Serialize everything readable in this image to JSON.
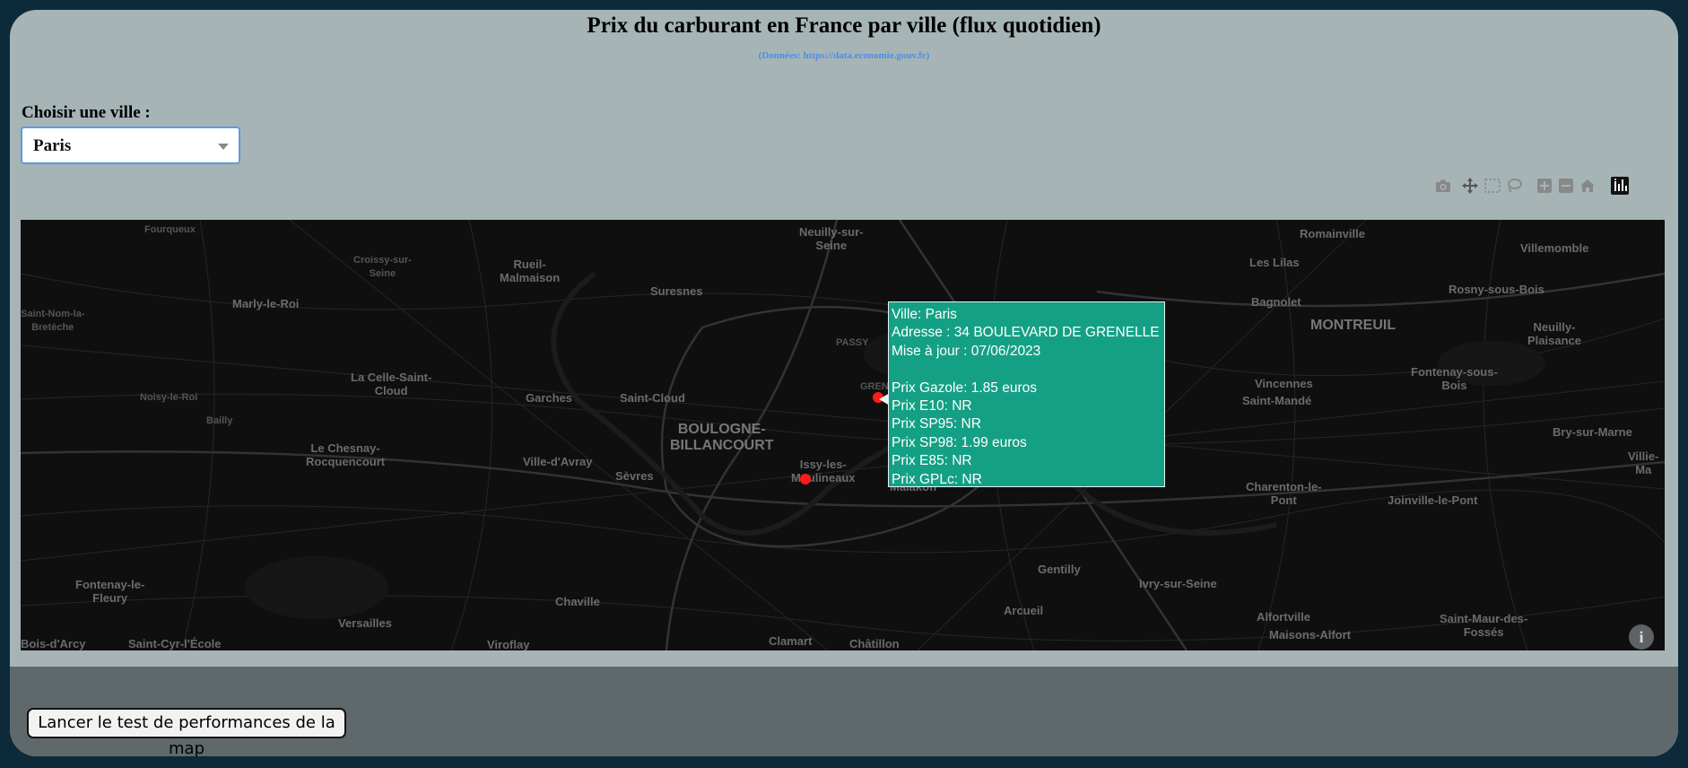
{
  "header": {
    "title": "Prix du carburant en France par ville (flux quotidien)",
    "subtitle": "(Données: https://data.economie.gouv.fr)"
  },
  "city_selector": {
    "label": "Choisir une ville :",
    "selected": "Paris"
  },
  "modebar": {
    "icons": [
      "camera-icon",
      "pan-icon",
      "box-select-icon",
      "lasso-icon",
      "zoom-in-icon",
      "zoom-out-icon",
      "home-icon",
      "plotly-logo-icon"
    ]
  },
  "map": {
    "places": [
      {
        "name": "Fourqueux",
        "size": "small"
      },
      {
        "name": "Croissy-sur-\nSeine",
        "size": "small"
      },
      {
        "name": "Rueil-\nMalmaison",
        "size": "normal"
      },
      {
        "name": "Neuilly-sur-\nSeine",
        "size": "normal"
      },
      {
        "name": "Romainville",
        "size": "normal"
      },
      {
        "name": "Villemomble",
        "size": "normal"
      },
      {
        "name": "Les Lilas",
        "size": "normal"
      },
      {
        "name": "Marly-le-Roi",
        "size": "normal"
      },
      {
        "name": "Suresnes",
        "size": "normal"
      },
      {
        "name": "Rosny-sous-Bois",
        "size": "normal"
      },
      {
        "name": "Saint-Nom-la-\nBretèche",
        "size": "small"
      },
      {
        "name": "Bagnolet",
        "size": "normal"
      },
      {
        "name": "MONTREUIL",
        "size": "big"
      },
      {
        "name": "Neuilly-\nPlaisance",
        "size": "normal"
      },
      {
        "name": "PASSY",
        "size": "small"
      },
      {
        "name": "La Celle-Saint-\nCloud",
        "size": "normal"
      },
      {
        "name": "Fontenay-sous-\nBois",
        "size": "normal"
      },
      {
        "name": "Vincennes",
        "size": "normal"
      },
      {
        "name": "Noisy-le-Roi",
        "size": "small"
      },
      {
        "name": "Garches",
        "size": "normal"
      },
      {
        "name": "Saint-Cloud",
        "size": "normal"
      },
      {
        "name": "Saint-Mandé",
        "size": "normal"
      },
      {
        "name": "Bailly",
        "size": "small"
      },
      {
        "name": "BOULOGNE-\nBILLANCOURT",
        "size": "big"
      },
      {
        "name": "Bry-sur-Marne",
        "size": "normal"
      },
      {
        "name": "Le Chesnay-\nRocquencourt",
        "size": "normal"
      },
      {
        "name": "Ville-d'Avray",
        "size": "normal"
      },
      {
        "name": "Issy-les-\nMoulineaux",
        "size": "normal"
      },
      {
        "name": "Sèvres",
        "size": "normal"
      },
      {
        "name": "Villie-\nMa",
        "size": "normal"
      },
      {
        "name": "Malakoff",
        "size": "normal"
      },
      {
        "name": "Charenton-le-\nPont",
        "size": "normal"
      },
      {
        "name": "Joinville-le-Pont",
        "size": "normal"
      },
      {
        "name": "Fontenay-le-\nFleury",
        "size": "normal"
      },
      {
        "name": "Gentilly",
        "size": "normal"
      },
      {
        "name": "Ivry-sur-Seine",
        "size": "normal"
      },
      {
        "name": "Chaville",
        "size": "normal"
      },
      {
        "name": "Arcueil",
        "size": "normal"
      },
      {
        "name": "Versailles",
        "size": "normal"
      },
      {
        "name": "Alfortville",
        "size": "normal"
      },
      {
        "name": "Saint-Maur-des-\nFossés",
        "size": "normal"
      },
      {
        "name": "Bois-d'Arcy",
        "size": "normal"
      },
      {
        "name": "Saint-Cyr-l'École",
        "size": "normal"
      },
      {
        "name": "Viroflay",
        "size": "normal"
      },
      {
        "name": "Clamart",
        "size": "normal"
      },
      {
        "name": "Châtillon",
        "size": "normal"
      },
      {
        "name": "Maisons-Alfort",
        "size": "normal"
      },
      {
        "name": "GRENE",
        "size": "small"
      }
    ],
    "stations": [
      {
        "ville": "Paris",
        "adresse": "34 BOULEVARD DE GRENELLE",
        "active": true
      },
      {
        "ville": "Paris",
        "adresse": "",
        "active": false
      }
    ],
    "hover": {
      "lines": [
        "Ville: Paris",
        "Adresse : 34 BOULEVARD DE GRENELLE",
        "Mise à jour : 07/06/2023",
        "",
        "Prix Gazole: 1.85 euros",
        "Prix E10: NR",
        "Prix SP95: NR",
        "Prix SP98: 1.99 euros",
        "Prix E85: NR",
        "Prix GPLc: NR"
      ]
    },
    "info_label": "i",
    "marker_color": "#ff1a1a",
    "tooltip_color": "#14a085"
  },
  "footer": {
    "perf_button": "Lancer le test de performances de la map"
  }
}
